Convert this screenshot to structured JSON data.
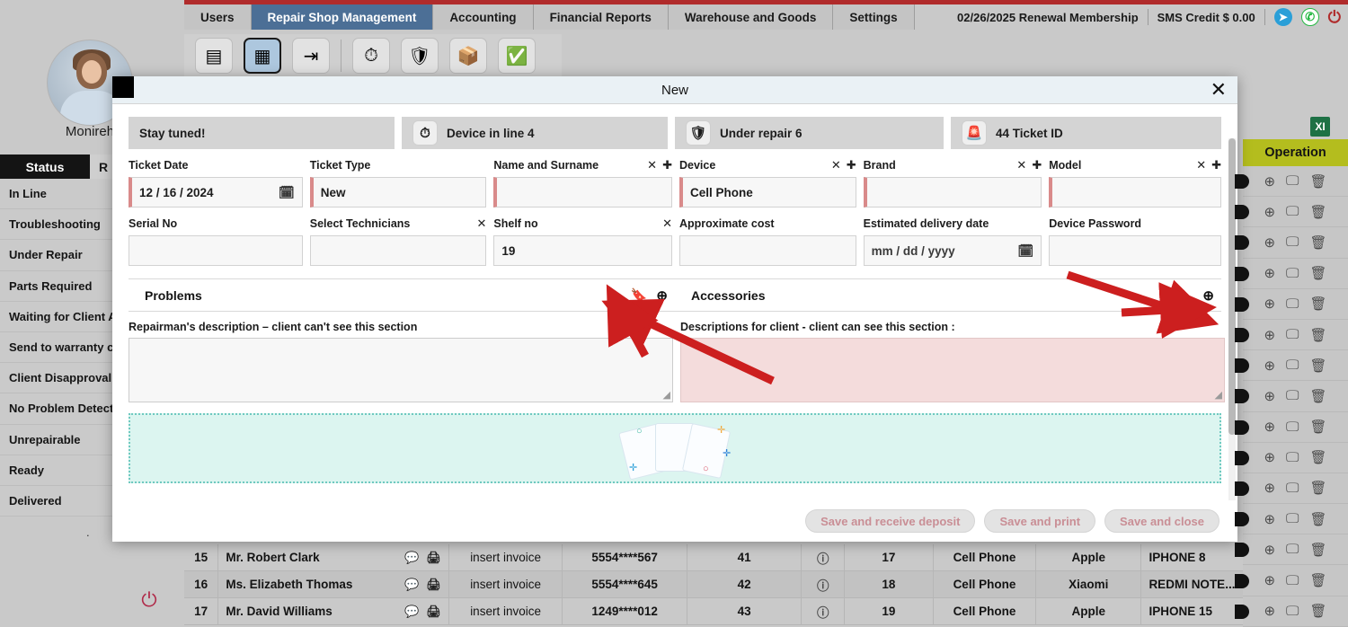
{
  "app": {
    "user_name": "Monireh",
    "menu_icon": "hamburger-icon",
    "power_icon": "power-icon",
    "excel_icon": "XI"
  },
  "topbar": {
    "tabs": [
      {
        "label": "Users",
        "active": false
      },
      {
        "label": "Repair Shop Management",
        "active": true
      },
      {
        "label": "Accounting",
        "active": false
      },
      {
        "label": "Financial Reports",
        "active": false
      },
      {
        "label": "Warehouse and Goods",
        "active": false
      },
      {
        "label": "Settings",
        "active": false
      }
    ],
    "membership": "02/26/2025 Renewal Membership",
    "sms_credit": "SMS Credit $ 0.00",
    "telegram_icon": "➤",
    "whatsapp_icon": "✆",
    "power_icon": "⏻"
  },
  "toolbar": {
    "buttons": [
      {
        "name": "list-view-button",
        "glyph": "▤"
      },
      {
        "name": "register-device-button",
        "glyph": "▦"
      },
      {
        "name": "check-in-button",
        "glyph": "⇥"
      },
      {
        "name": "in-line-button",
        "glyph": "⏱"
      },
      {
        "name": "under-repair-button",
        "glyph": "🛡"
      },
      {
        "name": "parts-button",
        "glyph": "📦"
      },
      {
        "name": "ready-button",
        "glyph": "✅"
      }
    ]
  },
  "sidebar": {
    "header": "Status",
    "header2": "R",
    "items": [
      "In Line",
      "Troubleshooting",
      "Under Repair",
      "Parts Required",
      "Waiting for Client Ap",
      "Send to warranty co",
      "Client Disapproval",
      "No Problem Detected",
      "Unrepairable",
      "Ready",
      "Delivered"
    ],
    "more": "."
  },
  "table": {
    "operation_header": "Operation",
    "rows": [
      {
        "idx": "15",
        "name": "Mr. Robert Clark",
        "invoice": "insert invoice",
        "phone": "5554****567",
        "n1": "41",
        "n2": "17",
        "device": "Cell Phone",
        "brand": "Apple",
        "model": "IPHONE 8"
      },
      {
        "idx": "16",
        "name": "Ms. Elizabeth Thomas",
        "invoice": "insert invoice",
        "phone": "5554****645",
        "n1": "42",
        "n2": "18",
        "device": "Cell Phone",
        "brand": "Xiaomi",
        "model": "REDMI NOTE..."
      },
      {
        "idx": "17",
        "name": "Mr. David Williams",
        "invoice": "insert invoice",
        "phone": "1249****012",
        "n1": "43",
        "n2": "19",
        "device": "Cell Phone",
        "brand": "Apple",
        "model": "IPHONE 15"
      }
    ],
    "row_icons": [
      "chat-icon",
      "print-icon"
    ],
    "op_icons": [
      "add-icon",
      "monitor-icon",
      "delete-icon"
    ]
  },
  "modal": {
    "title": "New",
    "close_label": "✕",
    "info": [
      {
        "name": "stay-tuned-box",
        "label": "Stay tuned!",
        "icon": null
      },
      {
        "name": "device-in-line-box",
        "label": "Device in line 4",
        "icon": "stopwatch-icon"
      },
      {
        "name": "under-repair-box",
        "label": "Under repair  6",
        "icon": "shield-pen-icon"
      },
      {
        "name": "ticket-id-box",
        "label": "44 Ticket ID",
        "icon": "alarm-icon"
      }
    ],
    "fields_row1": [
      {
        "name": "ticket-date",
        "label": "Ticket Date",
        "value": "12 / 16 / 2024",
        "placeholder": "",
        "actions": [],
        "calendar": true
      },
      {
        "name": "ticket-type",
        "label": "Ticket Type",
        "value": "New",
        "placeholder": "",
        "actions": [],
        "calendar": false
      },
      {
        "name": "name-and-surname",
        "label": "Name and Surname",
        "value": "",
        "placeholder": "",
        "actions": [
          "✕",
          "✚"
        ],
        "calendar": false
      },
      {
        "name": "device",
        "label": "Device",
        "value": "Cell Phone",
        "placeholder": "",
        "actions": [
          "✕",
          "✚"
        ],
        "calendar": false
      },
      {
        "name": "brand",
        "label": "Brand",
        "value": "",
        "placeholder": "",
        "actions": [
          "✕",
          "✚"
        ],
        "calendar": false
      },
      {
        "name": "model",
        "label": "Model",
        "value": "",
        "placeholder": "",
        "actions": [
          "✕",
          "✚"
        ],
        "calendar": false
      }
    ],
    "fields_row2": [
      {
        "name": "serial-no",
        "label": "Serial No",
        "value": "",
        "placeholder": "",
        "actions": [],
        "calendar": false,
        "accent": false
      },
      {
        "name": "select-technicians",
        "label": "Select Technicians",
        "value": "",
        "placeholder": "",
        "actions": [
          "✕"
        ],
        "calendar": false,
        "accent": false
      },
      {
        "name": "shelf-no",
        "label": "Shelf no",
        "value": "19",
        "placeholder": "",
        "actions": [
          "✕"
        ],
        "calendar": false,
        "accent": false
      },
      {
        "name": "approximate-cost",
        "label": "Approximate cost",
        "value": "",
        "placeholder": "",
        "actions": [],
        "calendar": false,
        "accent": false
      },
      {
        "name": "estimated-delivery-date",
        "label": "Estimated delivery date",
        "value": "",
        "placeholder": "mm / dd / yyyy",
        "actions": [],
        "calendar": true,
        "accent": false
      },
      {
        "name": "device-password",
        "label": "Device Password",
        "value": "",
        "placeholder": "",
        "actions": [],
        "calendar": false,
        "accent": false
      }
    ],
    "sections": [
      {
        "name": "problems-section",
        "title": "Problems",
        "icons": [
          "bookmark-icon",
          "zoom-in-icon"
        ]
      },
      {
        "name": "accessories-section",
        "title": "Accessories",
        "icons": [
          "bookmark-icon",
          "zoom-in-icon"
        ]
      }
    ],
    "textareas": [
      {
        "name": "repairman-description",
        "label": "Repairman's description – client can't see this section",
        "value": ""
      },
      {
        "name": "client-description",
        "label": "Descriptions for client - client can see this section :",
        "value": ""
      }
    ],
    "dropzone": {
      "name": "file-dropzone",
      "label": ""
    },
    "footer_buttons": [
      {
        "name": "save-and-receive-deposit-button",
        "label": "Save and receive deposit"
      },
      {
        "name": "save-and-print-button",
        "label": "Save and print"
      },
      {
        "name": "save-and-close-button",
        "label": "Save and close"
      }
    ]
  },
  "colors": {
    "accent_tab": "#4c6f96",
    "red_bar": "#b02b2b",
    "operation_header": "#b4bd1e",
    "dropzone_bg": "#dcf5f0",
    "pink_textarea": "#f4dcdc",
    "annotation": "#cc1f1f"
  }
}
